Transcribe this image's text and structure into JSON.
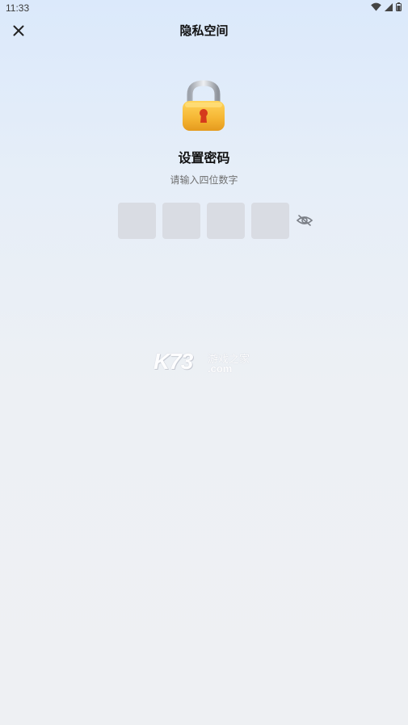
{
  "status_bar": {
    "time": "11:33"
  },
  "nav": {
    "title": "隐私空间"
  },
  "content": {
    "heading": "设置密码",
    "subheading": "请输入四位数字",
    "pin_count": 4
  },
  "watermark": {
    "main": "K73",
    "cn": "游戏之家",
    "domain": ".com"
  },
  "icons": {
    "close": "close-icon",
    "lock": "padlock-icon",
    "eye": "eye-off-icon",
    "wifi": "wifi-icon",
    "signal": "signal-icon",
    "battery": "battery-icon"
  },
  "colors": {
    "pin_box": "#d9dce3",
    "lock_body": "#f5b533",
    "keyhole": "#d53a1c"
  }
}
